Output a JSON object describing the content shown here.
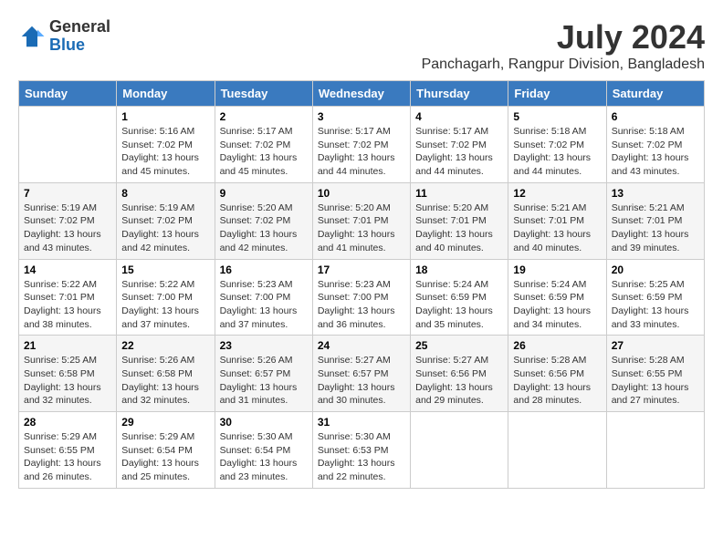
{
  "header": {
    "logo_line1": "General",
    "logo_line2": "Blue",
    "title": "July 2024",
    "subtitle": "Panchagarh, Rangpur Division, Bangladesh"
  },
  "weekdays": [
    "Sunday",
    "Monday",
    "Tuesday",
    "Wednesday",
    "Thursday",
    "Friday",
    "Saturday"
  ],
  "weeks": [
    [
      {
        "day": "",
        "info": ""
      },
      {
        "day": "1",
        "info": "Sunrise: 5:16 AM\nSunset: 7:02 PM\nDaylight: 13 hours\nand 45 minutes."
      },
      {
        "day": "2",
        "info": "Sunrise: 5:17 AM\nSunset: 7:02 PM\nDaylight: 13 hours\nand 45 minutes."
      },
      {
        "day": "3",
        "info": "Sunrise: 5:17 AM\nSunset: 7:02 PM\nDaylight: 13 hours\nand 44 minutes."
      },
      {
        "day": "4",
        "info": "Sunrise: 5:17 AM\nSunset: 7:02 PM\nDaylight: 13 hours\nand 44 minutes."
      },
      {
        "day": "5",
        "info": "Sunrise: 5:18 AM\nSunset: 7:02 PM\nDaylight: 13 hours\nand 44 minutes."
      },
      {
        "day": "6",
        "info": "Sunrise: 5:18 AM\nSunset: 7:02 PM\nDaylight: 13 hours\nand 43 minutes."
      }
    ],
    [
      {
        "day": "7",
        "info": "Sunrise: 5:19 AM\nSunset: 7:02 PM\nDaylight: 13 hours\nand 43 minutes."
      },
      {
        "day": "8",
        "info": "Sunrise: 5:19 AM\nSunset: 7:02 PM\nDaylight: 13 hours\nand 42 minutes."
      },
      {
        "day": "9",
        "info": "Sunrise: 5:20 AM\nSunset: 7:02 PM\nDaylight: 13 hours\nand 42 minutes."
      },
      {
        "day": "10",
        "info": "Sunrise: 5:20 AM\nSunset: 7:01 PM\nDaylight: 13 hours\nand 41 minutes."
      },
      {
        "day": "11",
        "info": "Sunrise: 5:20 AM\nSunset: 7:01 PM\nDaylight: 13 hours\nand 40 minutes."
      },
      {
        "day": "12",
        "info": "Sunrise: 5:21 AM\nSunset: 7:01 PM\nDaylight: 13 hours\nand 40 minutes."
      },
      {
        "day": "13",
        "info": "Sunrise: 5:21 AM\nSunset: 7:01 PM\nDaylight: 13 hours\nand 39 minutes."
      }
    ],
    [
      {
        "day": "14",
        "info": "Sunrise: 5:22 AM\nSunset: 7:01 PM\nDaylight: 13 hours\nand 38 minutes."
      },
      {
        "day": "15",
        "info": "Sunrise: 5:22 AM\nSunset: 7:00 PM\nDaylight: 13 hours\nand 37 minutes."
      },
      {
        "day": "16",
        "info": "Sunrise: 5:23 AM\nSunset: 7:00 PM\nDaylight: 13 hours\nand 37 minutes."
      },
      {
        "day": "17",
        "info": "Sunrise: 5:23 AM\nSunset: 7:00 PM\nDaylight: 13 hours\nand 36 minutes."
      },
      {
        "day": "18",
        "info": "Sunrise: 5:24 AM\nSunset: 6:59 PM\nDaylight: 13 hours\nand 35 minutes."
      },
      {
        "day": "19",
        "info": "Sunrise: 5:24 AM\nSunset: 6:59 PM\nDaylight: 13 hours\nand 34 minutes."
      },
      {
        "day": "20",
        "info": "Sunrise: 5:25 AM\nSunset: 6:59 PM\nDaylight: 13 hours\nand 33 minutes."
      }
    ],
    [
      {
        "day": "21",
        "info": "Sunrise: 5:25 AM\nSunset: 6:58 PM\nDaylight: 13 hours\nand 32 minutes."
      },
      {
        "day": "22",
        "info": "Sunrise: 5:26 AM\nSunset: 6:58 PM\nDaylight: 13 hours\nand 32 minutes."
      },
      {
        "day": "23",
        "info": "Sunrise: 5:26 AM\nSunset: 6:57 PM\nDaylight: 13 hours\nand 31 minutes."
      },
      {
        "day": "24",
        "info": "Sunrise: 5:27 AM\nSunset: 6:57 PM\nDaylight: 13 hours\nand 30 minutes."
      },
      {
        "day": "25",
        "info": "Sunrise: 5:27 AM\nSunset: 6:56 PM\nDaylight: 13 hours\nand 29 minutes."
      },
      {
        "day": "26",
        "info": "Sunrise: 5:28 AM\nSunset: 6:56 PM\nDaylight: 13 hours\nand 28 minutes."
      },
      {
        "day": "27",
        "info": "Sunrise: 5:28 AM\nSunset: 6:55 PM\nDaylight: 13 hours\nand 27 minutes."
      }
    ],
    [
      {
        "day": "28",
        "info": "Sunrise: 5:29 AM\nSunset: 6:55 PM\nDaylight: 13 hours\nand 26 minutes."
      },
      {
        "day": "29",
        "info": "Sunrise: 5:29 AM\nSunset: 6:54 PM\nDaylight: 13 hours\nand 25 minutes."
      },
      {
        "day": "30",
        "info": "Sunrise: 5:30 AM\nSunset: 6:54 PM\nDaylight: 13 hours\nand 23 minutes."
      },
      {
        "day": "31",
        "info": "Sunrise: 5:30 AM\nSunset: 6:53 PM\nDaylight: 13 hours\nand 22 minutes."
      },
      {
        "day": "",
        "info": ""
      },
      {
        "day": "",
        "info": ""
      },
      {
        "day": "",
        "info": ""
      }
    ]
  ]
}
